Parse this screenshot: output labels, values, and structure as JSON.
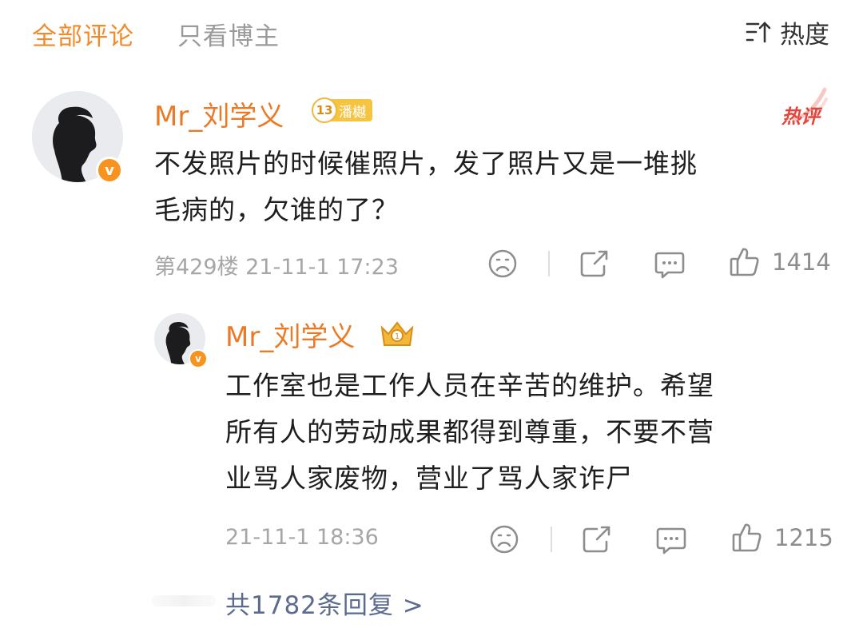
{
  "header": {
    "tab_all": "全部评论",
    "tab_host": "只看博主",
    "sort_label": "热度",
    "sort_icon": "sort-icon",
    "accent_color": "#f28a2c"
  },
  "comment": {
    "author": "Mr_刘学义",
    "level": "13",
    "level_title": "潘樾",
    "hot_tag": "热评",
    "text_line1": "不发照片的时候催照片，发了照片又是一堆挑",
    "text_line2": "毛病的，欠谁的了？",
    "floor_time": "第429楼 21-11-1 17:23",
    "likes": "1414",
    "verified_badge": "v"
  },
  "reply": {
    "author": "Mr_刘学义",
    "text_line1": "工作室也是工作人员在辛苦的维护。希望",
    "text_line2": "所有人的劳动成果都得到尊重，不要不营",
    "text_line3": "业骂人家废物，营业了骂人家诈尸",
    "time": "21-11-1 18:36",
    "likes": "1215",
    "verified_badge": "v"
  },
  "more_replies": "共1782条回复 >"
}
